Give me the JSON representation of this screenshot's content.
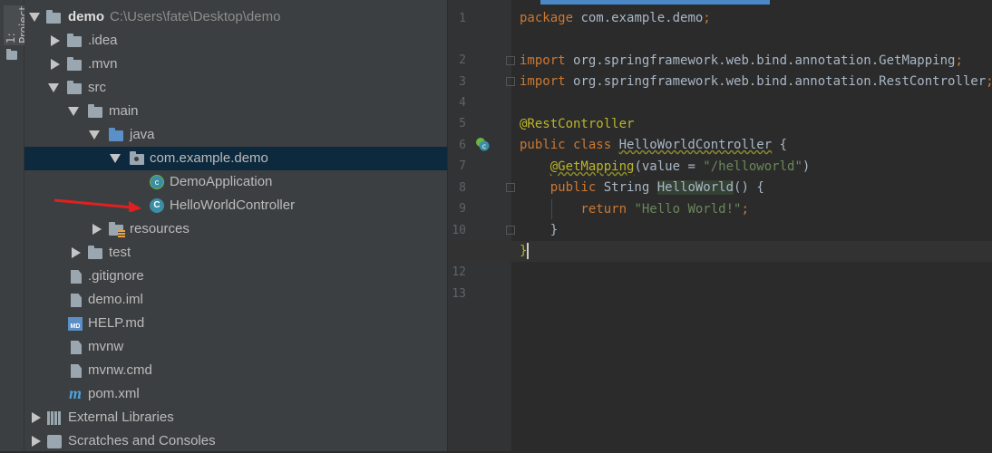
{
  "side_tab": {
    "label": "1: Project"
  },
  "tree": {
    "root": {
      "name": "demo",
      "path": "C:\\Users\\fate\\Desktop\\demo"
    },
    "items": [
      {
        "label": ".idea"
      },
      {
        "label": ".mvn"
      },
      {
        "label": "src"
      },
      {
        "label": "main"
      },
      {
        "label": "java"
      },
      {
        "label": "com.example.demo"
      },
      {
        "label": "DemoApplication"
      },
      {
        "label": "HelloWorldController"
      },
      {
        "label": "resources"
      },
      {
        "label": "test"
      },
      {
        "label": ".gitignore"
      },
      {
        "label": "demo.iml"
      },
      {
        "label": "HELP.md"
      },
      {
        "label": "mvnw"
      },
      {
        "label": "mvnw.cmd"
      },
      {
        "label": "pom.xml"
      },
      {
        "label": "External Libraries"
      },
      {
        "label": "Scratches and Consoles"
      }
    ]
  },
  "editor": {
    "line_numbers": [
      "1",
      "2",
      "3",
      "4",
      "5",
      "6",
      "7",
      "8",
      "9",
      "10",
      "11",
      "12",
      "13"
    ],
    "code": {
      "l1a": "package ",
      "l1b": "com.example.demo",
      "l1c": ";",
      "l3a": "import ",
      "l3b": "org.springframework.web.bind.annotation.GetMapping",
      "l3c": ";",
      "l4a": "import ",
      "l4b": "org.springframework.web.bind.annotation.RestController",
      "l4c": ";",
      "l6": "@RestController",
      "l7a": "public class ",
      "l7b": "HelloWorldController",
      "l7c": " {",
      "l8a": "    ",
      "l8b": "@GetMapping",
      "l8c": "(value = ",
      "l8d": "\"/helloworld\"",
      "l8e": ")",
      "l9a": "    public ",
      "l9b": "String ",
      "l9c": "HelloWorld",
      "l9d": "() {",
      "l10a": "        return ",
      "l10b": "\"Hello World!\"",
      "l10c": ";",
      "l11": "    }",
      "l12": "}"
    }
  }
}
